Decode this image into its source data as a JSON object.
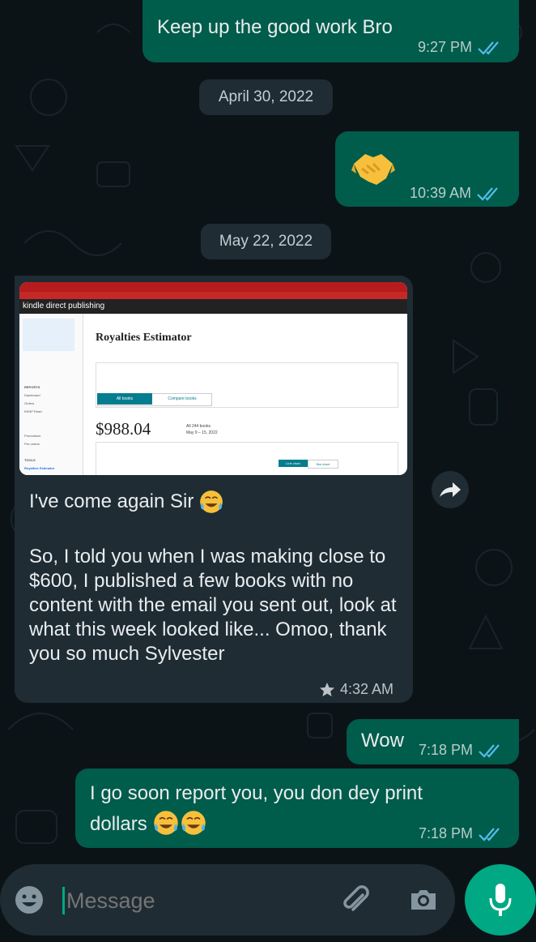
{
  "messages": [
    {
      "text": "Keep up the good work Bro",
      "time": "9:27 PM"
    },
    {
      "date": "April 30, 2022"
    },
    {
      "emoji": "handshake-emoji",
      "time": "10:39 AM"
    },
    {
      "date": "May 22, 2022"
    },
    {
      "screenshot": {
        "brand": "kindle direct publishing",
        "page_title": "Royalties Estimator",
        "royalty_amount": "$988.04",
        "books_label": "All 244 books",
        "date_range": "May 9 – 15, 2022",
        "sidebar_items": [
          "REPORTS",
          "Dashboard",
          "Orders",
          "KENP Read",
          "Promotions",
          "Pre-orders",
          "TOOLS",
          "Royalties Estimator"
        ],
        "button_all_books": "All books",
        "button_compare": "Compare books",
        "line_chart": "Line chart",
        "bar_chart": "Bar chart"
      },
      "paragraph1": "I've come again Sir",
      "paragraph2": "So, I told you when I was making close to $600, I published a few books with no content with the email you sent out, look at what this week looked like... Omoo, thank you so much Sylvester",
      "time": "4:32 AM"
    },
    {
      "text": "Wow",
      "time": "7:18 PM"
    },
    {
      "text": "I go soon report you, you don dey print dollars",
      "time": "7:18 PM"
    }
  ],
  "input": {
    "placeholder": "Message"
  },
  "colors": {
    "outgoing": "#005c4b",
    "incoming": "#1f2c34",
    "accent": "#00a884",
    "read_ticks": "#53bdeb"
  }
}
